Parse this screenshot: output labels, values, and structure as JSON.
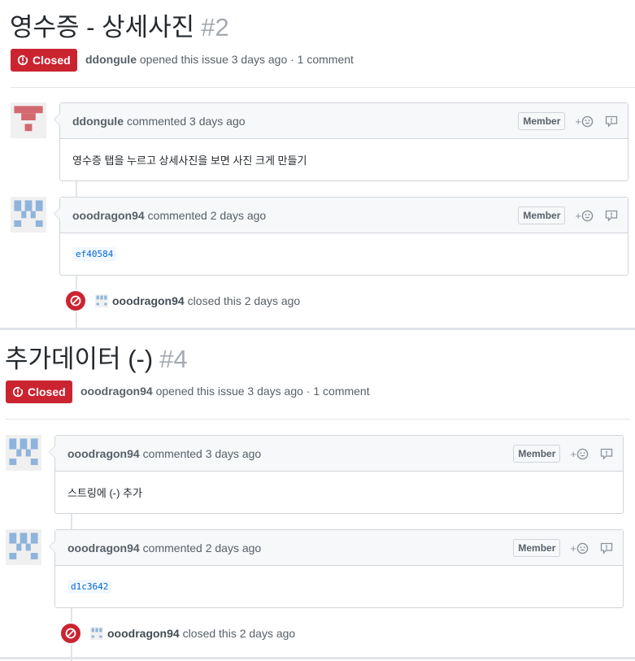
{
  "issues": [
    {
      "title": "영수증 - 상세사진",
      "number": "#2",
      "state": "Closed",
      "author": "ddongule",
      "opened_text": "opened this issue 3 days ago · 1 comment",
      "comments": [
        {
          "author": "ddongule",
          "time": "commented 3 days ago",
          "role": "Member",
          "body": "영수증 탭을 누르고 상세사진을 보면 사진 크게 만들기"
        },
        {
          "author": "ooodragon94",
          "time": "commented 2 days ago",
          "role": "Member",
          "body": "ef40584"
        }
      ],
      "closed_by": "ooodragon94",
      "closed_text": "closed this 2 days ago"
    },
    {
      "title": "추가데이터 (-)",
      "number": "#4",
      "state": "Closed",
      "author": "ooodragon94",
      "opened_text": "opened this issue 3 days ago · 1 comment",
      "comments": [
        {
          "author": "ooodragon94",
          "time": "commented 3 days ago",
          "role": "Member",
          "body": "스트링에 (-) 추가"
        },
        {
          "author": "ooodragon94",
          "time": "commented 2 days ago",
          "role": "Member",
          "body": "d1c3642"
        }
      ],
      "closed_by": "ooodragon94",
      "closed_text": "closed this 2 days ago"
    }
  ],
  "icons": {
    "state": "issue-closed-icon",
    "reaction": "smiley-icon",
    "more": "comment-more-icon",
    "closed_event": "circle-slash-icon"
  },
  "colors": {
    "closed_red": "#cb2431",
    "avatar_red": "#d36870",
    "avatar_blue": "#8fb4dc",
    "link_blue": "#0366d6"
  }
}
